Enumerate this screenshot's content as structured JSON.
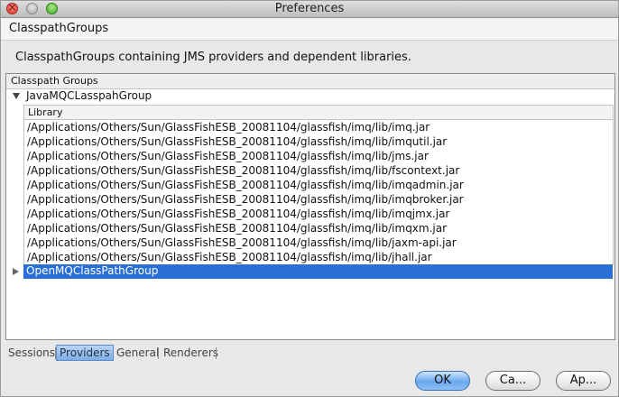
{
  "window": {
    "title": "Preferences"
  },
  "page": {
    "title": "ClasspathGroups",
    "description": "ClasspathGroups containing JMS providers and dependent libraries."
  },
  "group_box": {
    "header": "Classpath Groups"
  },
  "tree": {
    "expanded_group": "JavaMQCLasspahGroup",
    "library_header": "Library",
    "libraries": [
      "/Applications/Others/Sun/GlassFishESB_20081104/glassfish/imq/lib/imq.jar",
      "/Applications/Others/Sun/GlassFishESB_20081104/glassfish/imq/lib/imqutil.jar",
      "/Applications/Others/Sun/GlassFishESB_20081104/glassfish/imq/lib/jms.jar",
      "/Applications/Others/Sun/GlassFishESB_20081104/glassfish/imq/lib/fscontext.jar",
      "/Applications/Others/Sun/GlassFishESB_20081104/glassfish/imq/lib/imqadmin.jar",
      "/Applications/Others/Sun/GlassFishESB_20081104/glassfish/imq/lib/imqbroker.jar",
      "/Applications/Others/Sun/GlassFishESB_20081104/glassfish/imq/lib/imqjmx.jar",
      "/Applications/Others/Sun/GlassFishESB_20081104/glassfish/imq/lib/imqxm.jar",
      "/Applications/Others/Sun/GlassFishESB_20081104/glassfish/imq/lib/jaxm-api.jar",
      "/Applications/Others/Sun/GlassFishESB_20081104/glassfish/imq/lib/jhall.jar"
    ],
    "collapsed_group": "OpenMQClassPathGroup"
  },
  "tabs": [
    {
      "label": "Sessions",
      "selected": false
    },
    {
      "label": "Providers",
      "selected": true
    },
    {
      "label": "General",
      "selected": false
    },
    {
      "label": "Renderers",
      "selected": false
    }
  ],
  "buttons": {
    "ok": "OK",
    "cancel": "Ca...",
    "apply": "Ap..."
  },
  "colors": {
    "selection": "#2a6fd6",
    "accent": "#6aa7ee"
  }
}
